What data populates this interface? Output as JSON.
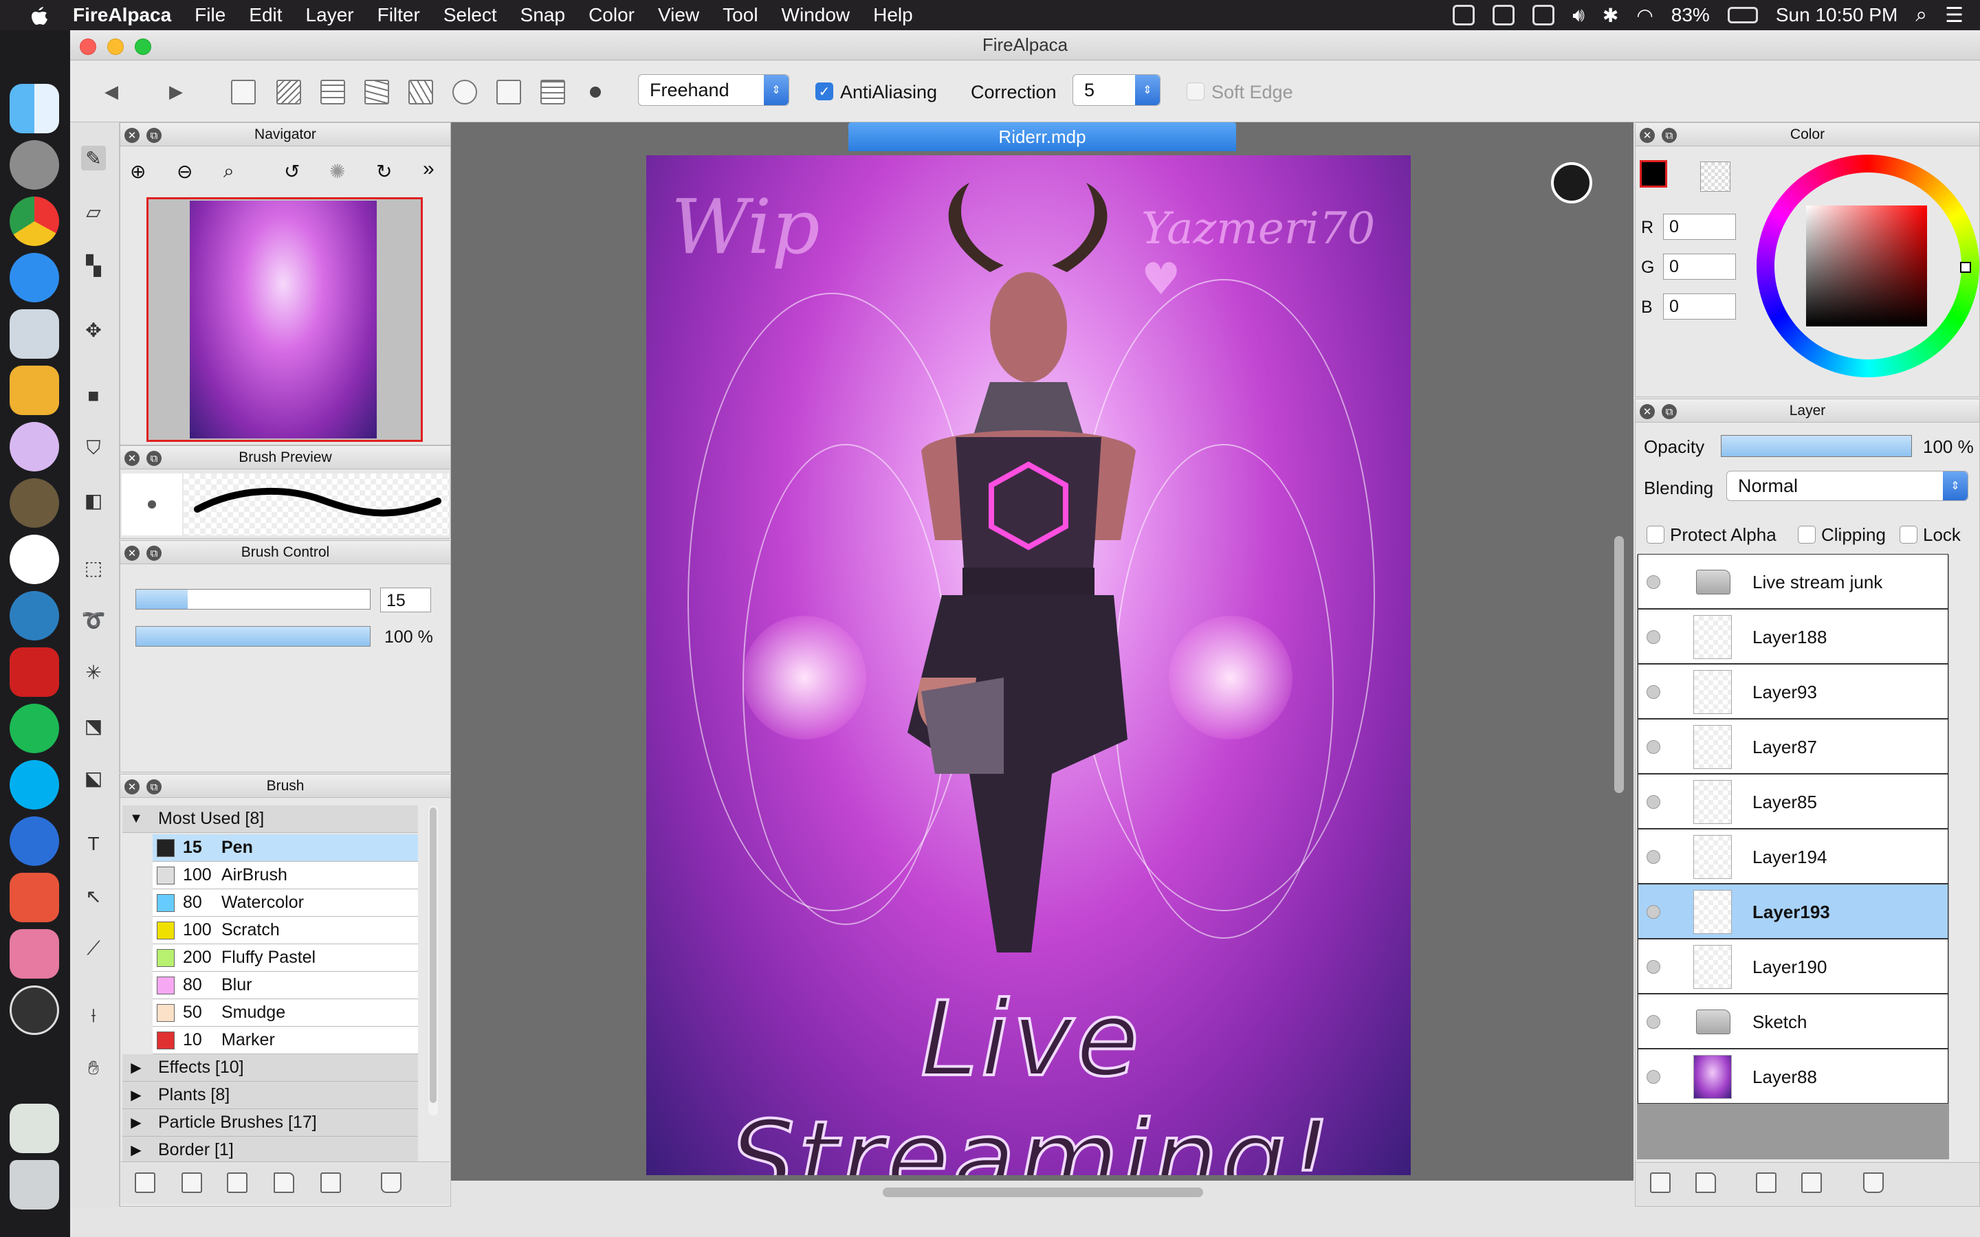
{
  "menubar": {
    "app_name": "FireAlpaca",
    "items": [
      "File",
      "Edit",
      "Layer",
      "Filter",
      "Select",
      "Snap",
      "Color",
      "View",
      "Tool",
      "Window",
      "Help"
    ],
    "battery": "83%",
    "clock": "Sun 10:50 PM"
  },
  "window": {
    "title": "FireAlpaca"
  },
  "toolbar": {
    "shape_mode": "Freehand",
    "antialiasing_label": "AntiAliasing",
    "antialiasing_checked": true,
    "correction_label": "Correction",
    "correction_value": "5",
    "soft_edge_label": "Soft Edge"
  },
  "navigator": {
    "title": "Navigator"
  },
  "brush_preview": {
    "title": "Brush Preview"
  },
  "brush_control": {
    "title": "Brush Control",
    "size_value": "15",
    "opacity_value": "100 %",
    "size_fraction": 0.22,
    "opacity_fraction": 1.0
  },
  "brush_panel": {
    "title": "Brush",
    "group_most_used": "Most Used [8]",
    "brushes": [
      {
        "size": "15",
        "name": "Pen",
        "color": "#222222",
        "selected": true
      },
      {
        "size": "100",
        "name": "AirBrush",
        "color": "#dddddd"
      },
      {
        "size": "80",
        "name": "Watercolor",
        "color": "#66ccff"
      },
      {
        "size": "100",
        "name": "Scratch",
        "color": "#f0e000"
      },
      {
        "size": "200",
        "name": "Fluffy Pastel",
        "color": "#b8f070"
      },
      {
        "size": "80",
        "name": "Blur",
        "color": "#f7a8f2"
      },
      {
        "size": "50",
        "name": "Smudge",
        "color": "#fbe1c8"
      },
      {
        "size": "10",
        "name": "Marker",
        "color": "#e03030"
      }
    ],
    "groups": [
      "Effects [10]",
      "Plants [8]",
      "Particle Brushes [17]",
      "Border [1]"
    ]
  },
  "document": {
    "tab_title": "Riderr.mdp",
    "art_text_top_left": "Wip",
    "art_text_top_right": "Yazmeri70 ♥",
    "art_text_bottom": "Live Streaming!"
  },
  "color_panel": {
    "title": "Color",
    "r_label": "R",
    "r_value": "0",
    "g_label": "G",
    "g_value": "0",
    "b_label": "B",
    "b_value": "0"
  },
  "layer_panel": {
    "title": "Layer",
    "opacity_label": "Opacity",
    "opacity_value": "100 %",
    "opacity_fraction": 1.0,
    "blending_label": "Blending",
    "blending_value": "Normal",
    "protect_alpha_label": "Protect Alpha",
    "clipping_label": "Clipping",
    "lock_label": "Lock",
    "layers": [
      {
        "name": "Live stream junk",
        "type": "folder"
      },
      {
        "name": "Layer188",
        "type": "layer"
      },
      {
        "name": "Layer93",
        "type": "layer"
      },
      {
        "name": "Layer87",
        "type": "layer"
      },
      {
        "name": "Layer85",
        "type": "layer"
      },
      {
        "name": "Layer194",
        "type": "layer"
      },
      {
        "name": "Layer193",
        "type": "layer",
        "selected": true
      },
      {
        "name": "Layer190",
        "type": "layer"
      },
      {
        "name": "Sketch",
        "type": "folder"
      },
      {
        "name": "Layer88",
        "type": "layer"
      }
    ]
  }
}
